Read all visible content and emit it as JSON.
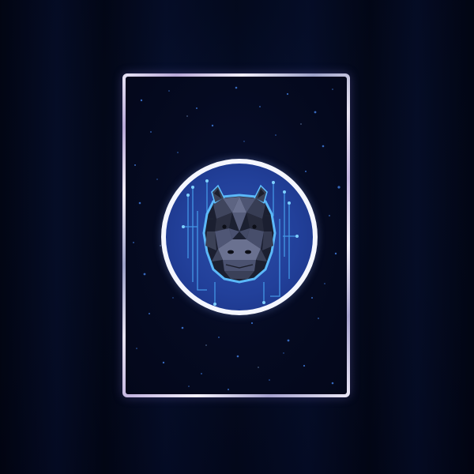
{
  "colors": {
    "background": "#040b22",
    "card_background": "#050a20",
    "frame_holo": "#e9e6f5",
    "medallion_blue": "#22409a",
    "medallion_ring": "#f4f6ff",
    "circuit_glow": "#4fb4ff",
    "hippo_dark": "#1b1e2b",
    "hippo_mid": "#3b4156",
    "hippo_light": "#6a7190"
  },
  "card": {
    "artwork": "hippo-icon"
  }
}
